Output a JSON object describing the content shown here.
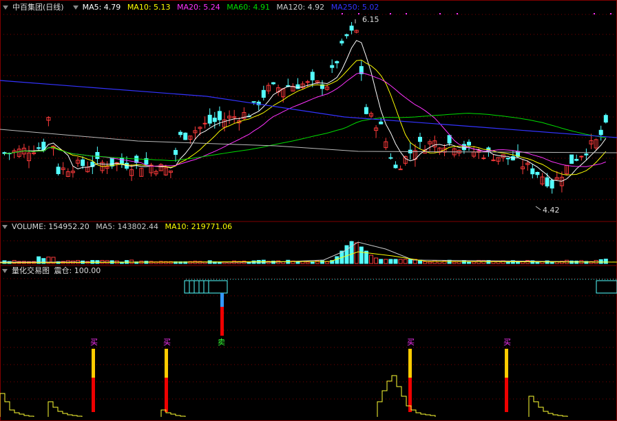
{
  "price_panel": {
    "title": "中百集团(日线)",
    "indicators": [
      {
        "label": "MA5: 4.79",
        "color": "#ffffff"
      },
      {
        "label": "MA10: 5.13",
        "color": "#ffff00"
      },
      {
        "label": "MA20: 5.24",
        "color": "#ff33ff"
      },
      {
        "label": "MA60: 4.91",
        "color": "#00dd00"
      },
      {
        "label": "MA120: 4.92",
        "color": "#cccccc"
      },
      {
        "label": "MA250: 5.02",
        "color": "#3333ff"
      }
    ],
    "high_label": "6.15",
    "low_label": "4.42"
  },
  "volume_panel": {
    "label_volume": "VOLUME: 154952.20",
    "label_ma5": "MA5: 143802.44",
    "label_ma10": "MA10: 219771.06",
    "color_ma5": "#cccccc",
    "color_ma10": "#ffff00"
  },
  "signal_panel": {
    "title": "量化交易图",
    "label": "震仓: 100.00",
    "buy_label": "买",
    "sell_label": "卖"
  },
  "colors": {
    "up": "#ff3b3b",
    "down": "#54ffff",
    "buy_text": "#ff33ff",
    "sell_text": "#33ff33",
    "bar_yellow": "#ffcc00",
    "bar_red": "#ee0000",
    "bar_blue": "#3399ff",
    "grid": "#800000"
  }
}
